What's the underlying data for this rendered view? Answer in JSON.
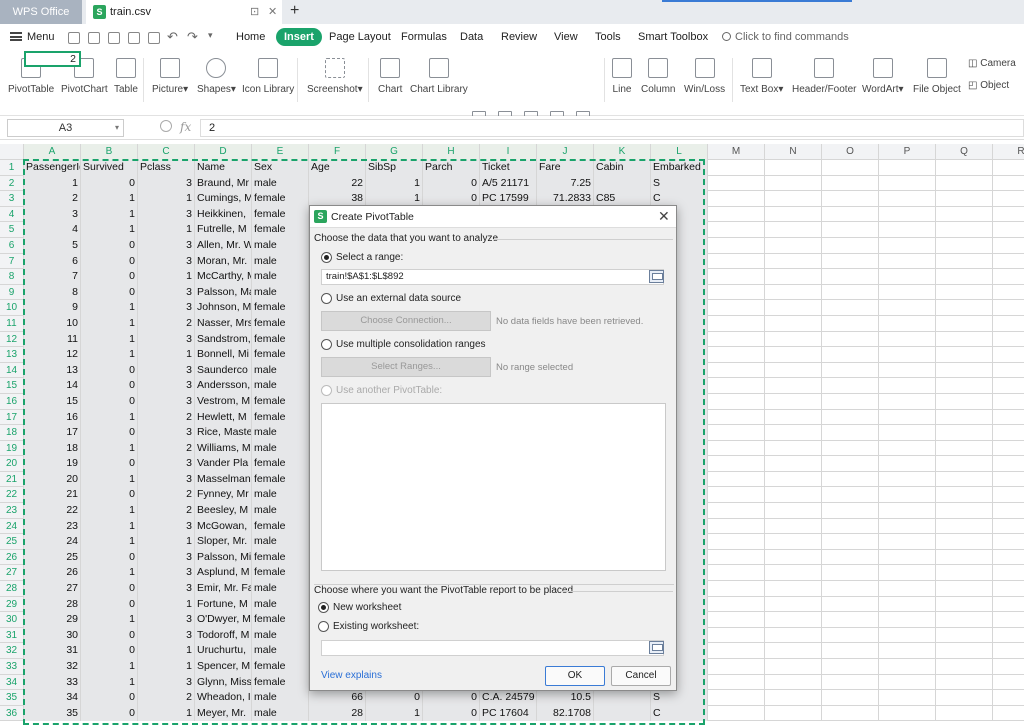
{
  "tabs": {
    "app": "WPS Office",
    "file": "train.csv",
    "pin": "⊡",
    "close": "✕",
    "add": "+"
  },
  "menubar": {
    "menu": "Menu",
    "items": [
      "Home",
      "Insert",
      "Page Layout",
      "Formulas",
      "Data",
      "Review",
      "View",
      "Tools",
      "Smart Toolbox"
    ],
    "active": "Insert",
    "search": "Click to find commands"
  },
  "ribbon": {
    "buttons": [
      "PivotTable",
      "PivotChart",
      "Table",
      "Picture",
      "Shapes",
      "Icon Library",
      "Screenshot",
      "Chart",
      "Chart Library",
      "Line",
      "Column",
      "Win/Loss",
      "Text Box",
      "Header/Footer",
      "WordArt",
      "File Object"
    ],
    "small": [
      "Camera",
      "Object"
    ],
    "dropdown_marker": "▾"
  },
  "formula": {
    "cell_ref": "A3",
    "fx": "fx",
    "value": "2"
  },
  "columns": [
    "A",
    "B",
    "C",
    "D",
    "E",
    "F",
    "G",
    "H",
    "I",
    "J",
    "K",
    "L",
    "M",
    "N",
    "O",
    "P",
    "Q",
    "R"
  ],
  "header_row": [
    "PassengerId",
    "Survived",
    "Pclass",
    "Name",
    "Sex",
    "Age",
    "SibSp",
    "Parch",
    "Ticket",
    "Fare",
    "Cabin",
    "Embarked"
  ],
  "rows": [
    [
      "1",
      "0",
      "3",
      "Braund, Mr",
      "male",
      "22",
      "1",
      "0",
      "A/5 21171",
      "7.25",
      "",
      "S"
    ],
    [
      "2",
      "1",
      "1",
      "Cumings, M",
      "female",
      "38",
      "1",
      "0",
      "PC 17599",
      "71.2833",
      "C85",
      "C"
    ],
    [
      "3",
      "1",
      "3",
      "Heikkinen,",
      "female",
      "",
      "",
      "",
      "",
      "",
      "",
      ""
    ],
    [
      "4",
      "1",
      "1",
      "Futrelle, M",
      "female",
      "",
      "",
      "",
      "",
      "",
      "",
      ""
    ],
    [
      "5",
      "0",
      "3",
      "Allen, Mr. W",
      "male",
      "",
      "",
      "",
      "",
      "",
      "",
      ""
    ],
    [
      "6",
      "0",
      "3",
      "Moran, Mr.",
      "male",
      "",
      "",
      "",
      "",
      "",
      "",
      ""
    ],
    [
      "7",
      "0",
      "1",
      "McCarthy, M",
      "male",
      "",
      "",
      "",
      "",
      "",
      "",
      ""
    ],
    [
      "8",
      "0",
      "3",
      "Palsson, Ma",
      "male",
      "",
      "",
      "",
      "",
      "",
      "",
      ""
    ],
    [
      "9",
      "1",
      "3",
      "Johnson, M",
      "female",
      "",
      "",
      "",
      "",
      "",
      "",
      ""
    ],
    [
      "10",
      "1",
      "2",
      "Nasser, Mrs",
      "female",
      "",
      "",
      "",
      "",
      "",
      "",
      ""
    ],
    [
      "11",
      "1",
      "3",
      "Sandstrom,",
      "female",
      "",
      "",
      "",
      "",
      "",
      "",
      ""
    ],
    [
      "12",
      "1",
      "1",
      "Bonnell, Mi",
      "female",
      "",
      "",
      "",
      "",
      "",
      "",
      ""
    ],
    [
      "13",
      "0",
      "3",
      "Saunderco",
      "male",
      "",
      "",
      "",
      "",
      "",
      "",
      ""
    ],
    [
      "14",
      "0",
      "3",
      "Andersson,",
      "male",
      "",
      "",
      "",
      "",
      "",
      "",
      ""
    ],
    [
      "15",
      "0",
      "3",
      "Vestrom, M",
      "female",
      "",
      "",
      "",
      "",
      "",
      "",
      ""
    ],
    [
      "16",
      "1",
      "2",
      "Hewlett, M",
      "female",
      "",
      "",
      "",
      "",
      "",
      "",
      ""
    ],
    [
      "17",
      "0",
      "3",
      "Rice, Maste",
      "male",
      "",
      "",
      "",
      "",
      "",
      "",
      ""
    ],
    [
      "18",
      "1",
      "2",
      "Williams, M",
      "male",
      "",
      "",
      "",
      "",
      "",
      "",
      ""
    ],
    [
      "19",
      "0",
      "3",
      "Vander Pla",
      "female",
      "",
      "",
      "",
      "",
      "",
      "",
      ""
    ],
    [
      "20",
      "1",
      "3",
      "Masselman",
      "female",
      "",
      "",
      "",
      "",
      "",
      "",
      ""
    ],
    [
      "21",
      "0",
      "2",
      "Fynney, Mr",
      "male",
      "",
      "",
      "",
      "",
      "",
      "",
      ""
    ],
    [
      "22",
      "1",
      "2",
      "Beesley, M",
      "male",
      "",
      "",
      "",
      "",
      "",
      "",
      ""
    ],
    [
      "23",
      "1",
      "3",
      "McGowan,",
      "female",
      "",
      "",
      "",
      "",
      "",
      "",
      ""
    ],
    [
      "24",
      "1",
      "1",
      "Sloper, Mr.",
      "male",
      "",
      "",
      "",
      "",
      "",
      "",
      ""
    ],
    [
      "25",
      "0",
      "3",
      "Palsson, Mi",
      "female",
      "",
      "",
      "",
      "",
      "",
      "",
      ""
    ],
    [
      "26",
      "1",
      "3",
      "Asplund, M",
      "female",
      "",
      "",
      "",
      "",
      "",
      "",
      ""
    ],
    [
      "27",
      "0",
      "3",
      "Emir, Mr. Fa",
      "male",
      "",
      "",
      "",
      "",
      "",
      "",
      ""
    ],
    [
      "28",
      "0",
      "1",
      "Fortune, M",
      "male",
      "",
      "",
      "",
      "",
      "",
      "",
      ""
    ],
    [
      "29",
      "1",
      "3",
      "O'Dwyer, M",
      "female",
      "",
      "",
      "",
      "",
      "",
      "",
      ""
    ],
    [
      "30",
      "0",
      "3",
      "Todoroff, M",
      "male",
      "",
      "",
      "",
      "",
      "",
      "",
      ""
    ],
    [
      "31",
      "0",
      "1",
      "Uruchurtu,",
      "male",
      "",
      "",
      "",
      "",
      "",
      "",
      ""
    ],
    [
      "32",
      "1",
      "1",
      "Spencer, M",
      "female",
      "",
      "",
      "",
      "",
      "",
      "",
      ""
    ],
    [
      "33",
      "1",
      "3",
      "Glynn, Miss",
      "female",
      "",
      "",
      "",
      "",
      "",
      "",
      ""
    ],
    [
      "34",
      "0",
      "2",
      "Wheadon, I",
      "male",
      "66",
      "0",
      "0",
      "C.A. 24579",
      "10.5",
      "",
      "S"
    ],
    [
      "35",
      "0",
      "1",
      "Meyer, Mr.",
      "male",
      "28",
      "1",
      "0",
      "PC 17604",
      "82.1708",
      "",
      "C"
    ]
  ],
  "dialog": {
    "title": "Create PivotTable",
    "section1": "Choose the data that you want to analyze",
    "opt_range": "Select a range:",
    "range_value": "train!$A$1:$L$892",
    "opt_external": "Use an external data source",
    "btn_connection": "Choose Connection...",
    "note_connection": "No data fields have been retrieved.",
    "opt_multiple": "Use multiple consolidation ranges",
    "btn_ranges": "Select Ranges...",
    "note_ranges": "No range selected",
    "opt_another": "Use another PivotTable:",
    "section2": "Choose where you want the PivotTable report to be placed",
    "opt_new": "New worksheet",
    "opt_existing": "Existing worksheet:",
    "view_explains": "View explains",
    "ok": "OK",
    "cancel": "Cancel",
    "close": "✕"
  },
  "colors": {
    "accent": "#1aa36b",
    "link": "#2a6fd6"
  }
}
